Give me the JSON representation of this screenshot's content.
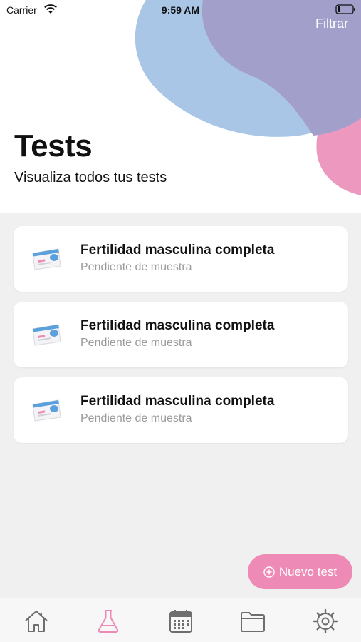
{
  "status_bar": {
    "carrier": "Carrier",
    "time": "9:59 AM"
  },
  "header": {
    "filter_label": "Filtrar",
    "title": "Tests",
    "subtitle": "Visualiza todos tus tests"
  },
  "tests": [
    {
      "name": "Fertilidad masculina completa",
      "status": "Pendiente de muestra",
      "icon": "test-kit-icon"
    },
    {
      "name": "Fertilidad masculina completa",
      "status": "Pendiente de muestra",
      "icon": "test-kit-icon"
    },
    {
      "name": "Fertilidad masculina completa",
      "status": "Pendiente de muestra",
      "icon": "test-kit-icon"
    }
  ],
  "fab": {
    "label": "Nuevo test",
    "icon": "plus-circle-icon"
  },
  "tab_bar": {
    "items": [
      {
        "icon": "home-icon",
        "active": false
      },
      {
        "icon": "flask-icon",
        "active": true
      },
      {
        "icon": "calendar-icon",
        "active": false
      },
      {
        "icon": "folder-icon",
        "active": false
      },
      {
        "icon": "gear-icon",
        "active": false
      }
    ]
  },
  "colors": {
    "accent_pink": "#ee8ab6",
    "blob_blue": "#a9c6e6",
    "blob_purple": "#a29fca",
    "blob_pink": "#ec98bf",
    "background": "#f0f0f0",
    "inactive_icon": "#6e6e6e"
  }
}
